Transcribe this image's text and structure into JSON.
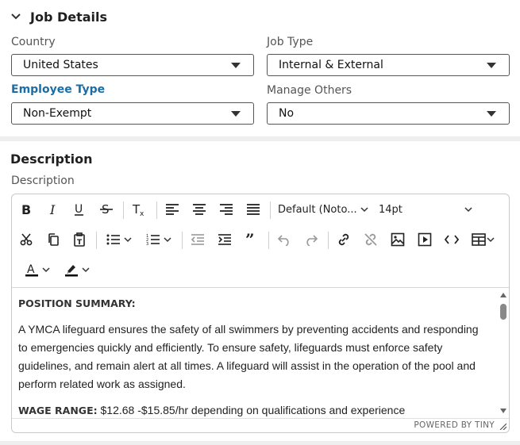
{
  "job_details": {
    "title": "Job Details",
    "country": {
      "label": "Country",
      "value": "United States"
    },
    "job_type": {
      "label": "Job Type",
      "value": "Internal & External"
    },
    "employee_type": {
      "label": "Employee Type",
      "value": "Non-Exempt"
    },
    "manage_others": {
      "label": "Manage Others",
      "value": "No"
    }
  },
  "description": {
    "title": "Description",
    "field_label": "Description",
    "toolbar": {
      "font_family": "Default (Noto...",
      "font_size": "14pt"
    },
    "content": {
      "heading": "POSITION SUMMARY:",
      "paragraph": "A YMCA lifeguard ensures the safety of all swimmers by preventing accidents and responding to emergencies quickly and efficiently. To ensure safety, lifeguards must enforce safety guidelines, and remain alert at all times. A lifeguard will assist in the operation of the pool and perform related work as assigned.",
      "wage_label": "WAGE RANGE:",
      "wage_text": " $12.68 -$15.85/hr depending on qualifications and experience"
    },
    "powered_by": "POWERED BY TINY"
  },
  "icons": [
    "chevron-down-icon",
    "bold-icon",
    "italic-icon",
    "underline-icon",
    "strikethrough-icon",
    "clear-formatting-icon",
    "align-left-icon",
    "align-center-icon",
    "align-right-icon",
    "justify-icon",
    "cut-icon",
    "copy-icon",
    "paste-text-icon",
    "bullet-list-icon",
    "numbered-list-icon",
    "outdent-icon",
    "indent-icon",
    "blockquote-icon",
    "undo-icon",
    "redo-icon",
    "link-icon",
    "unlink-icon",
    "image-icon",
    "media-icon",
    "code-icon",
    "table-icon",
    "text-color-icon",
    "highlight-icon"
  ],
  "colors": {
    "accent": "#1a6ea8",
    "divider": "#eeeeee"
  }
}
